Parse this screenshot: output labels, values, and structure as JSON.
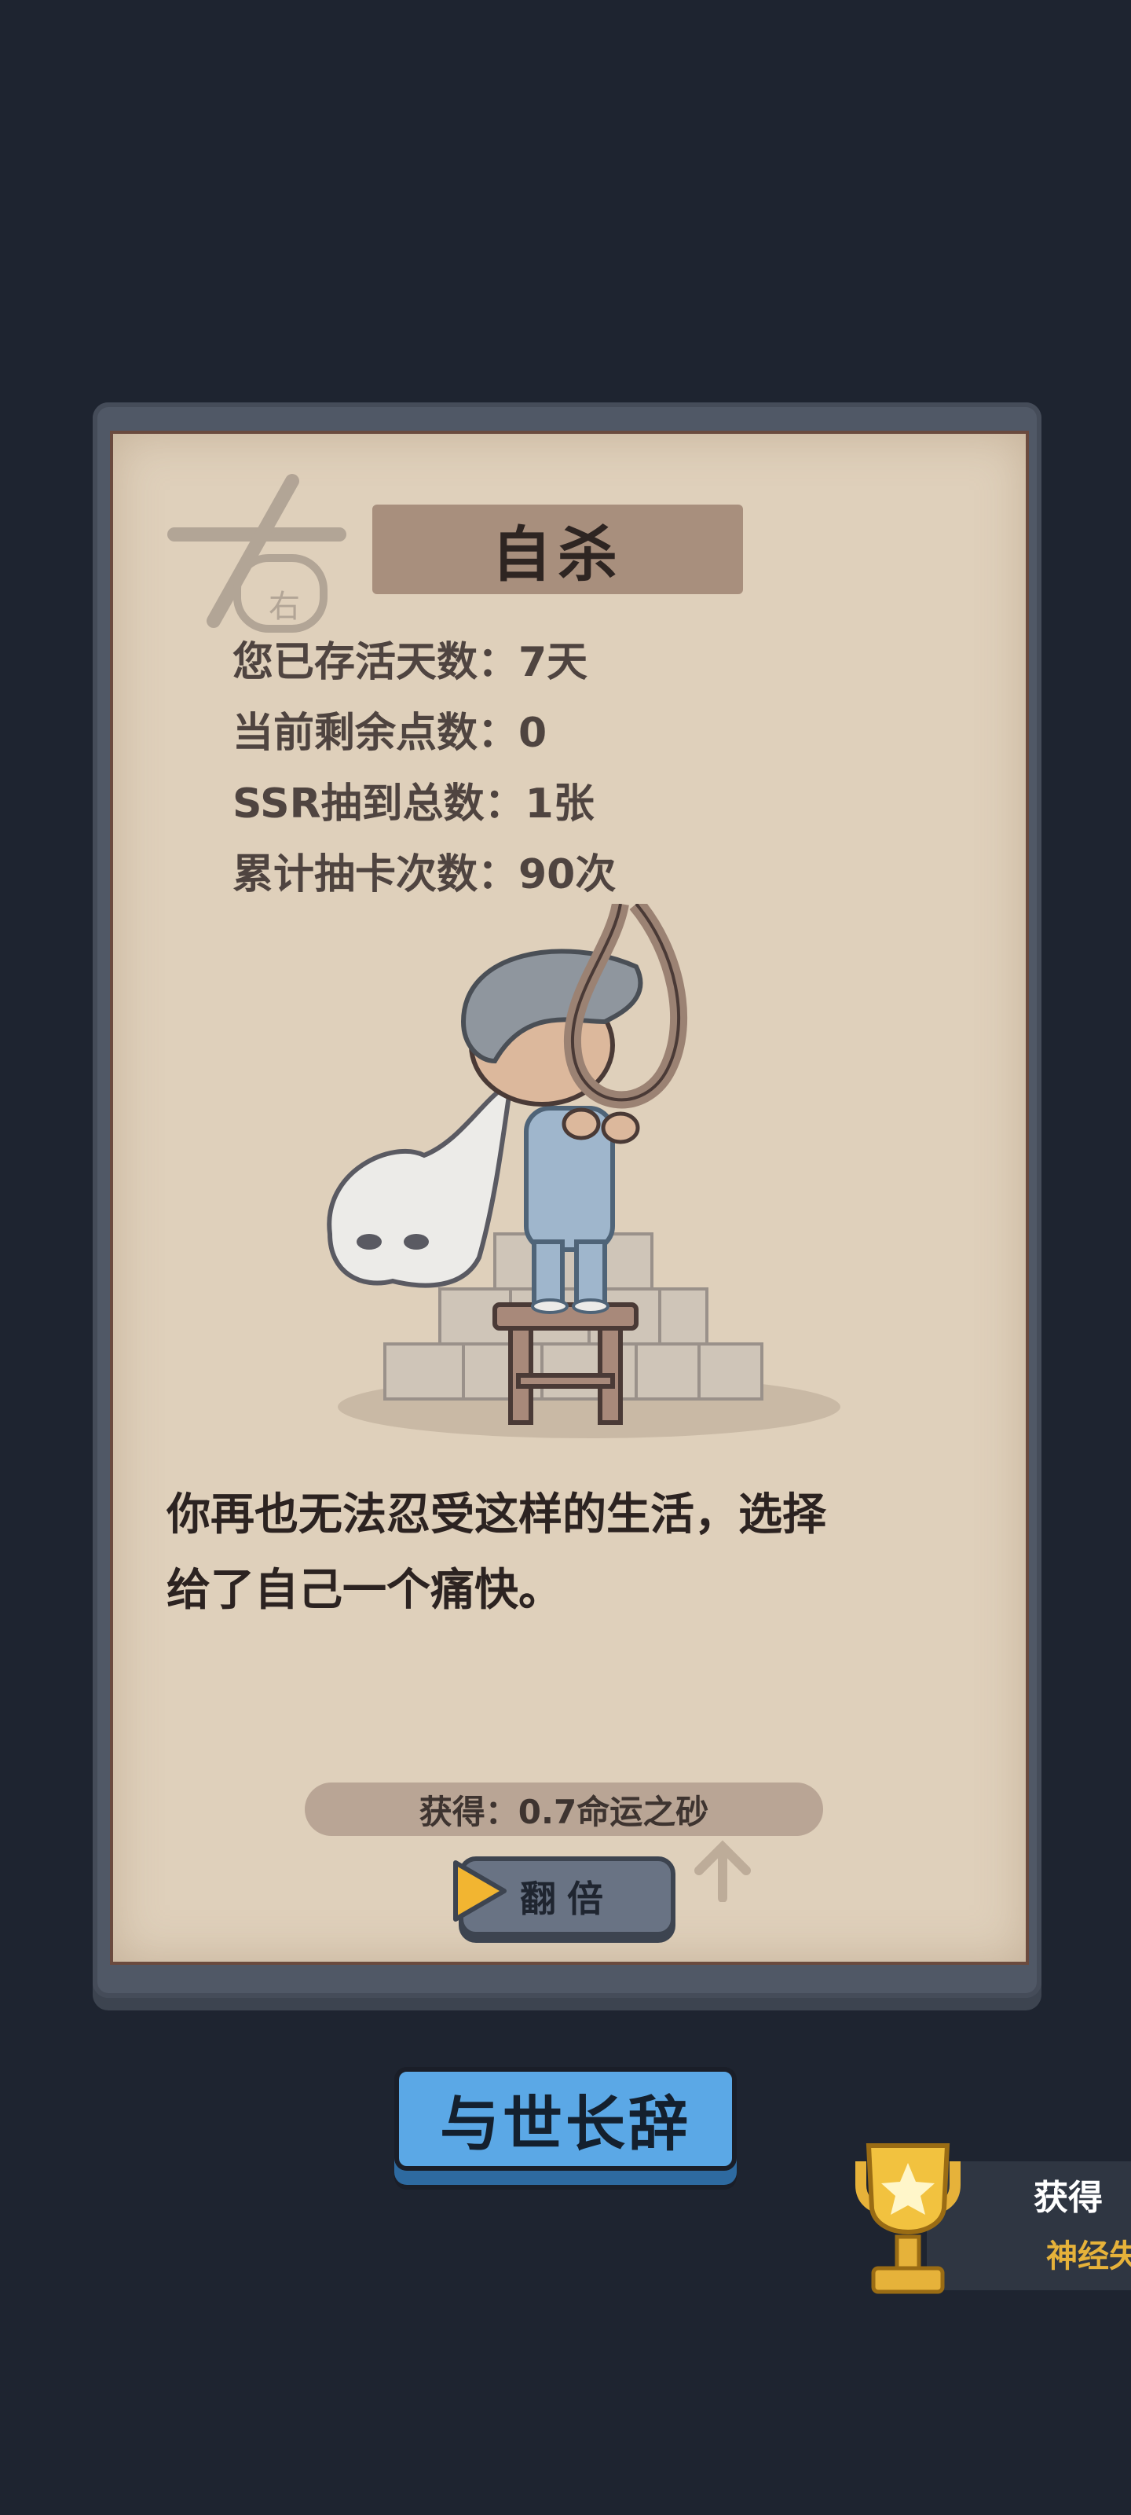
{
  "card": {
    "title": "自杀",
    "stamp_text": "右",
    "stats": [
      "您已存活天数：7天",
      "当前剩余点数：0",
      "SSR抽到总数：1张",
      "累计抽卡次数：90次"
    ],
    "story_lines": [
      "你再也无法忍受这样的生活，选择",
      "给了自己一个痛快。"
    ],
    "reward": "获得：0.7命运之砂",
    "double_button": "翻倍"
  },
  "main_button": "与世长辞",
  "achievement": {
    "title": "获得",
    "subtitle": "神经失"
  },
  "colors": {
    "background": "#1e2430",
    "paper": "#dfd0bb",
    "main_button": "#5ba8e6",
    "achievement_accent": "#e6b23a"
  },
  "icons": [
    "stamp-icon",
    "play-triangle-icon",
    "up-arrow-icon",
    "trophy-icon",
    "star-icon"
  ]
}
